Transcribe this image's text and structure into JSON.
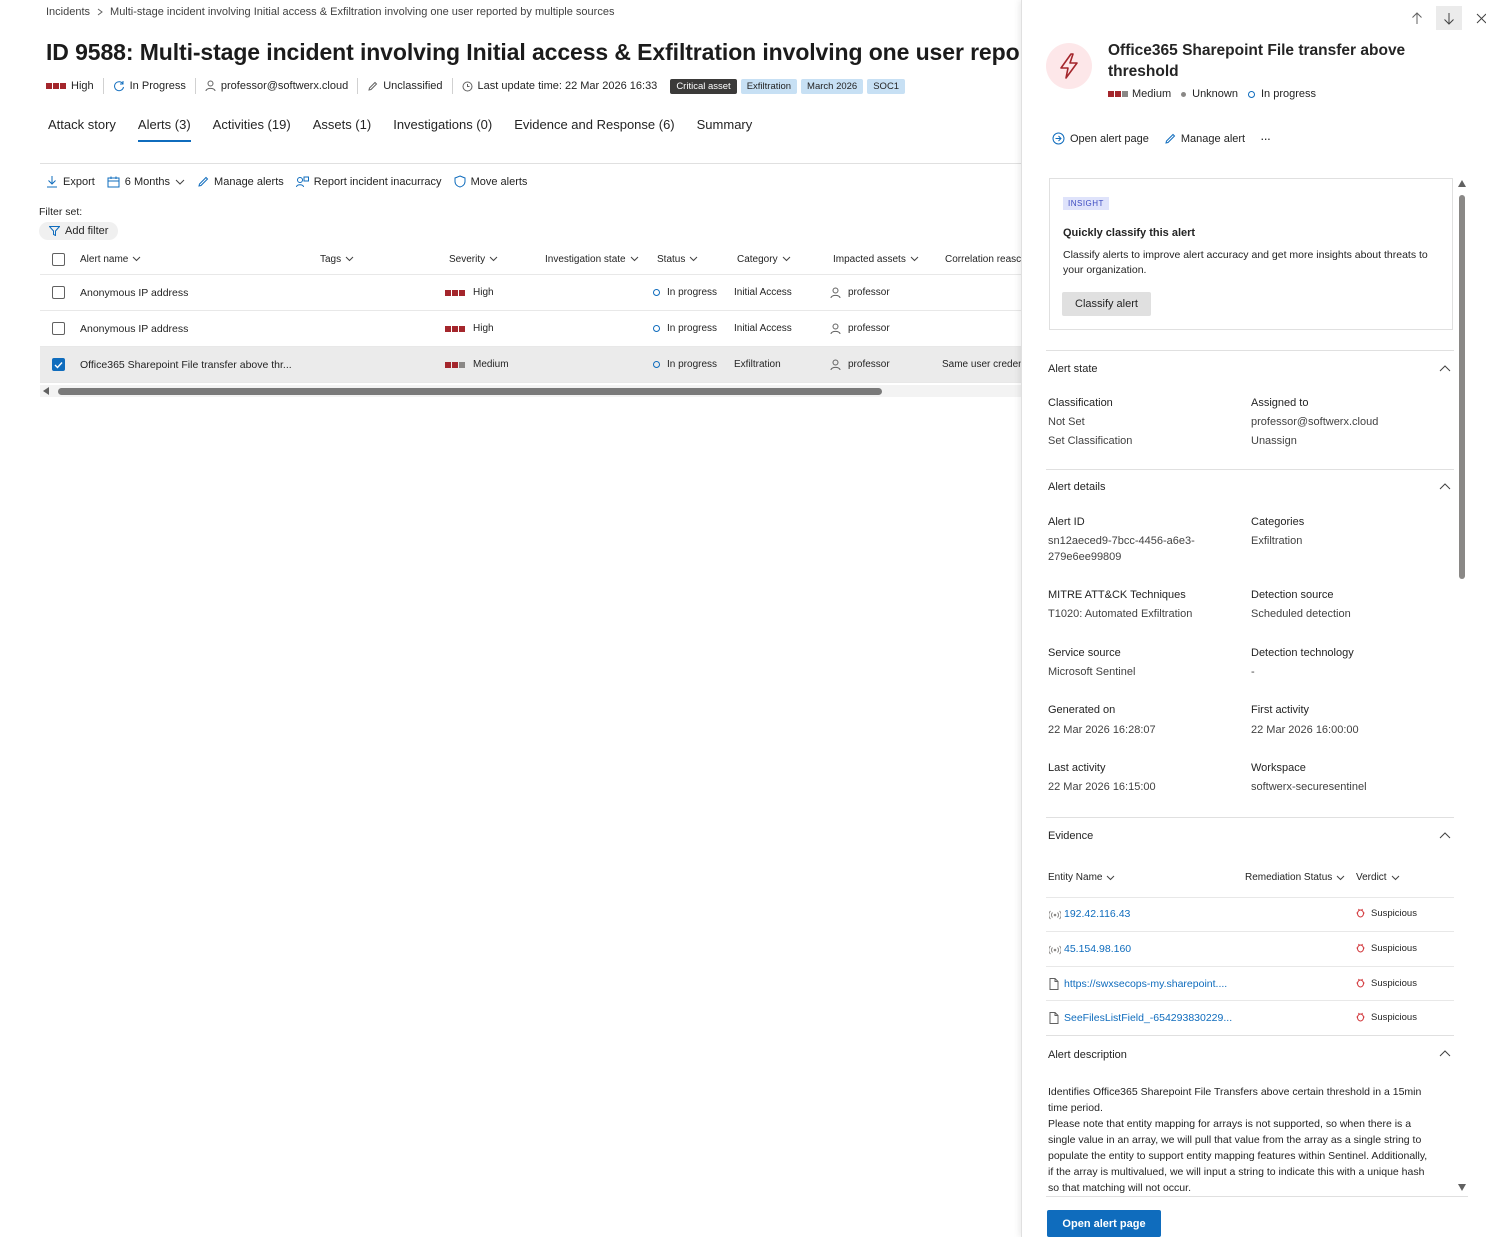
{
  "breadcrumb": {
    "root": "Incidents",
    "current": "Multi-stage incident involving Initial access & Exfiltration involving one user reported by multiple sources"
  },
  "incident": {
    "title": "ID 9588: Multi-stage incident involving Initial access & Exfiltration involving one user reporte",
    "severity": "High",
    "status": "In Progress",
    "assigned": "professor@softwerx.cloud",
    "classification": "Unclassified",
    "last_update": "Last update time: 22 Mar 2026 16:33",
    "tags": [
      "Critical asset",
      "Exfiltration",
      "March 2026",
      "SOC1"
    ]
  },
  "tabs": [
    "Attack story",
    "Alerts (3)",
    "Activities (19)",
    "Assets (1)",
    "Investigations (0)",
    "Evidence and Response (6)",
    "Summary"
  ],
  "toolbar": {
    "export": "Export",
    "period": "6 Months",
    "manage": "Manage alerts",
    "report": "Report incident inacurracy",
    "move": "Move alerts"
  },
  "filter": {
    "label": "Filter set:",
    "add": "Add filter"
  },
  "table": {
    "headers": [
      "Alert name",
      "Tags",
      "Severity",
      "Investigation state",
      "Status",
      "Category",
      "Impacted assets",
      "Correlation reasc"
    ],
    "rows": [
      {
        "name": "Anonymous IP address",
        "severity": "High",
        "status": "In progress",
        "category": "Initial Access",
        "asset": "professor",
        "correlation": ""
      },
      {
        "name": "Anonymous IP address",
        "severity": "High",
        "status": "In progress",
        "category": "Initial Access",
        "asset": "professor",
        "correlation": ""
      },
      {
        "name": "Office365 Sharepoint File transfer above thr...",
        "severity": "Medium",
        "status": "In progress",
        "category": "Exfiltration",
        "asset": "professor",
        "correlation": "Same user credent"
      }
    ]
  },
  "panel": {
    "title": "Office365 Sharepoint File transfer above threshold",
    "severity": "Medium",
    "determination": "Unknown",
    "status": "In progress",
    "actions": {
      "open": "Open alert page",
      "manage": "Manage alert",
      "more": "···"
    },
    "insight": {
      "badge": "INSIGHT",
      "title": "Quickly classify this alert",
      "desc": "Classify alerts to improve alert accuracy and get more insights about threats to your organization.",
      "button": "Classify alert"
    },
    "alert_state": {
      "title": "Alert state",
      "classification_label": "Classification",
      "classification": "Not Set",
      "set_classification": "Set Classification",
      "assigned_label": "Assigned to",
      "assigned": "professor@softwerx.cloud",
      "unassign": "Unassign"
    },
    "alert_details": {
      "title": "Alert details",
      "alert_id_label": "Alert ID",
      "alert_id_1": "sn12aeced9-7bcc-4456-a6e3-",
      "alert_id_2": "279e6ee99809",
      "categories_label": "Categories",
      "categories": "Exfiltration",
      "mitre_label": "MITRE ATT&CK Techniques",
      "mitre": "T1020: Automated Exfiltration",
      "detection_source_label": "Detection source",
      "detection_source": "Scheduled detection",
      "service_source_label": "Service source",
      "service_source": "Microsoft Sentinel",
      "detection_tech_label": "Detection technology",
      "detection_tech": "-",
      "generated_label": "Generated on",
      "generated": "22 Mar 2026 16:28:07",
      "first_label": "First activity",
      "first": "22 Mar 2026 16:00:00",
      "last_label": "Last activity",
      "last": "22 Mar 2026 16:15:00",
      "workspace_label": "Workspace",
      "workspace": "softwerx-securesentinel"
    },
    "evidence": {
      "title": "Evidence",
      "headers": [
        "Entity Name",
        "Remediation Status",
        "Verdict"
      ],
      "rows": [
        {
          "name": "192.42.116.43",
          "icon": "ip-icon",
          "verdict": "Suspicious"
        },
        {
          "name": "45.154.98.160",
          "icon": "ip-icon",
          "verdict": "Suspicious"
        },
        {
          "name": "https://swxsecops-my.sharepoint....",
          "icon": "file-icon",
          "verdict": "Suspicious"
        },
        {
          "name": "SeeFilesListField_-654293830229...",
          "icon": "file-icon",
          "verdict": "Suspicious"
        }
      ]
    },
    "description": {
      "title": "Alert description",
      "text": "Identifies Office365 Sharepoint File Transfers above certain threshold in a 15min time period.\n Please note that entity mapping for arrays is not supported, so when there is a single value in an array, we will pull that value from the array as a single string to populate the entity to support entity mapping features within Sentinel. Additionally, if the array is multivalued, we will input a string to indicate this with a unique hash so that matching will not occur."
    },
    "open_button": "Open alert page"
  },
  "colors": {
    "accent": "#0f6cbd",
    "severity_red": "#a4262c",
    "verdict_red": "#d13438"
  }
}
